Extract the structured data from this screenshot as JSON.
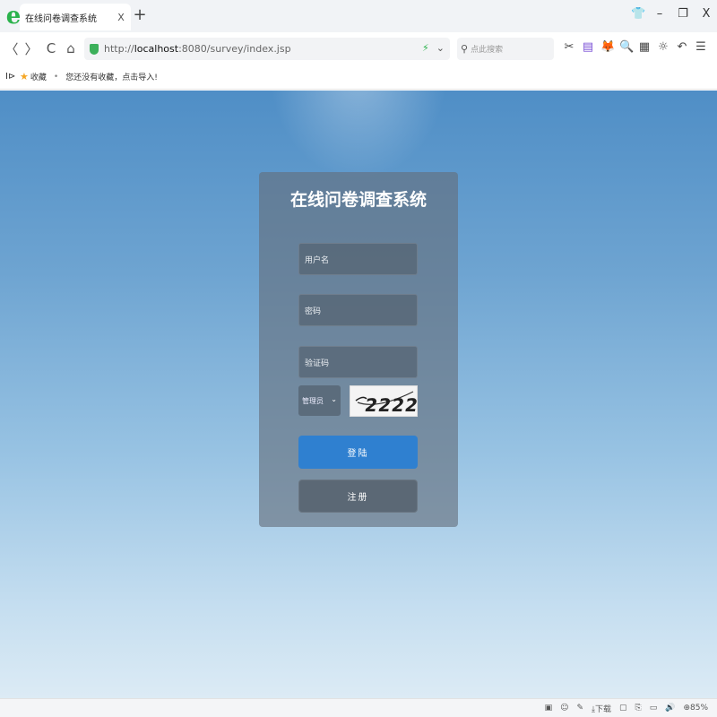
{
  "browser": {
    "tab_title": "在线问卷调查系统",
    "tab_close": "X",
    "new_tab": "+",
    "logo": "e",
    "window_controls": [
      "👕",
      "–",
      "❐",
      "X"
    ]
  },
  "navbar": {
    "back": "〈",
    "forward": "〉",
    "reload": "C",
    "home": "⌂",
    "url_prefix": "http://",
    "url_host": "localhost",
    "url_rest": ":8080/survey/index.jsp",
    "addr_flash": "⚡",
    "addr_dropdown": "⌄",
    "search_placeholder": "点此搜索",
    "search_icon": "⚲",
    "tools": [
      "✂",
      "▾",
      "▤",
      "▾",
      "🦊",
      "▾",
      "🔍",
      "▦",
      "☼",
      "↶",
      "▾",
      "☰"
    ]
  },
  "bookmarks": {
    "toggle": "I⊳",
    "star": "★",
    "label": "收藏",
    "separator": "•",
    "hint": "您还没有收藏，点击导入!"
  },
  "login": {
    "title": "在线问卷调查系统",
    "username_placeholder": "用户名",
    "password_placeholder": "密码",
    "captcha_placeholder": "验证码",
    "role_selected": "管理员",
    "role_arrow": "⌄",
    "captcha_text": "2222",
    "login_label": "登陆",
    "register_label": "注册"
  },
  "statusbar": {
    "items": [
      "▣",
      "☺",
      "✎",
      "⤓下载",
      "▢",
      "⎘",
      "▭",
      "🔊",
      "⊕85%"
    ]
  },
  "colors": {
    "login_button": "#2f80d0",
    "register_button": "#586470",
    "page_top": "#4f8ec6",
    "page_bottom": "#dcebf5"
  }
}
